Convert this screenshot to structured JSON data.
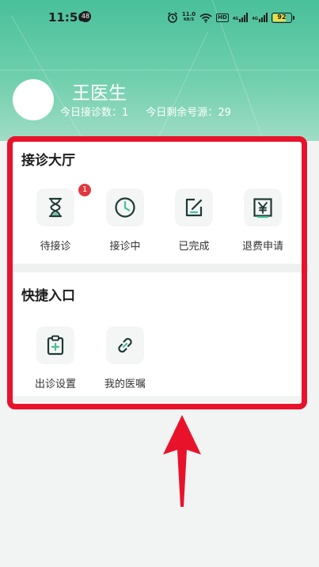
{
  "status_bar": {
    "time": "11:56",
    "notification_count": "48",
    "network_speed_value": "11.0",
    "network_speed_unit": "KB/S",
    "hd_label": "HD",
    "signal_label_1": "4G",
    "signal_label_2": "4G",
    "battery_level": "92",
    "battery_color": "#f0de3d"
  },
  "profile": {
    "name": "王医生",
    "today_visits_label": "今日接诊数：",
    "today_visits_value": "1",
    "remaining_slots_label": "今日剩余号源：",
    "remaining_slots_value": "29"
  },
  "consultation_hall": {
    "title": "接诊大厅",
    "items": [
      {
        "label": "待接诊",
        "icon": "hourglass-icon",
        "badge": "1"
      },
      {
        "label": "接诊中",
        "icon": "clock-icon"
      },
      {
        "label": "已完成",
        "icon": "edit-check-icon"
      },
      {
        "label": "退费申请",
        "icon": "yen-icon"
      }
    ]
  },
  "quick_entry": {
    "title": "快捷入口",
    "items": [
      {
        "label": "出诊设置",
        "icon": "clipboard-plus-icon"
      },
      {
        "label": "我的医嘱",
        "icon": "link-icon"
      }
    ]
  },
  "colors": {
    "brand_green": "#49c09a",
    "highlight_red": "#e8132b",
    "badge_red": "#e0393e",
    "icon_dark": "#1f3a34"
  }
}
